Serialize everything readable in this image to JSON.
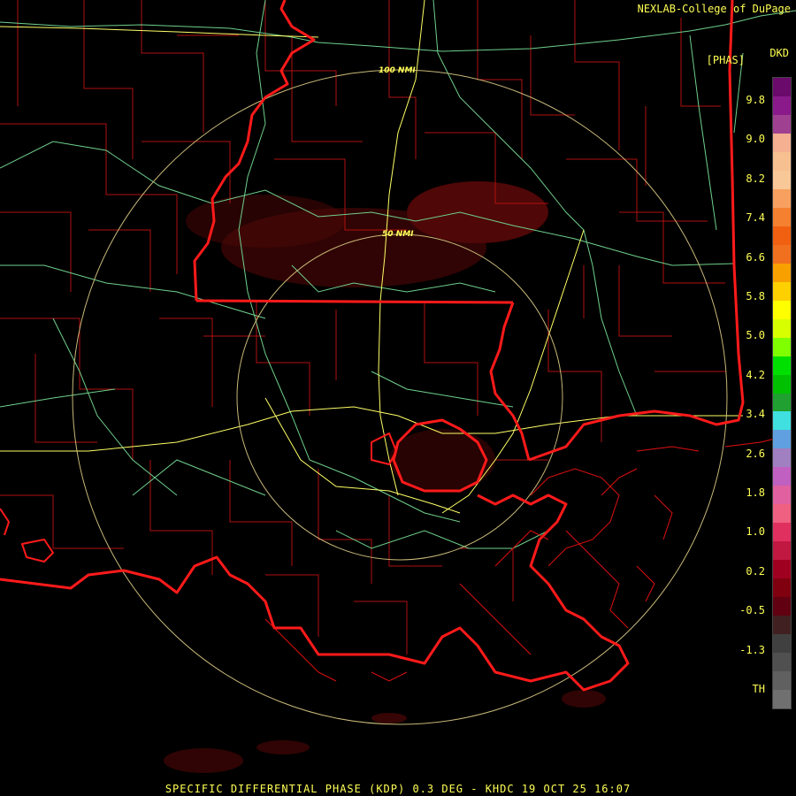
{
  "header": {
    "credit": "NEXLAB-College of DuPage",
    "product_code": "DKD",
    "unit": "[PHAS]"
  },
  "footer": {
    "caption": "SPECIFIC DIFFERENTIAL PHASE (KDP) 0.3 DEG - KHDC 19 OCT 25 16:07"
  },
  "range_rings": [
    {
      "label": "100 NMI"
    },
    {
      "label": "50 NMI"
    }
  ],
  "legend": {
    "ticks": [
      "9.8",
      "9.0",
      "8.2",
      "7.4",
      "6.6",
      "5.8",
      "5.0",
      "4.2",
      "3.4",
      "2.6",
      "1.8",
      "1.0",
      "0.2",
      "-0.5",
      "-1.3",
      "TH"
    ],
    "colors": [
      "#6a0a6a",
      "#8a1a8a",
      "#a04090",
      "#f4b090",
      "#f6c090",
      "#f8c898",
      "#f8a060",
      "#f48030",
      "#f06010",
      "#f07020",
      "#f8a000",
      "#ffd000",
      "#ffff00",
      "#d8ff00",
      "#80ff00",
      "#00e000",
      "#00c000",
      "#20a030",
      "#40e0e0",
      "#60a0e0",
      "#a080c0",
      "#c060c0",
      "#e060a0",
      "#f06080",
      "#e03060",
      "#c01840",
      "#a00020",
      "#800010",
      "#600010",
      "#402020",
      "#404040",
      "#505050",
      "#606060",
      "#707070"
    ]
  },
  "colors": {
    "state_line": "#ff1a1a",
    "county_line": "#b01010",
    "highway": "#6fd08c",
    "interstate": "#ffff66",
    "ring": "#c8b878",
    "echo": "#6a0a0a"
  }
}
